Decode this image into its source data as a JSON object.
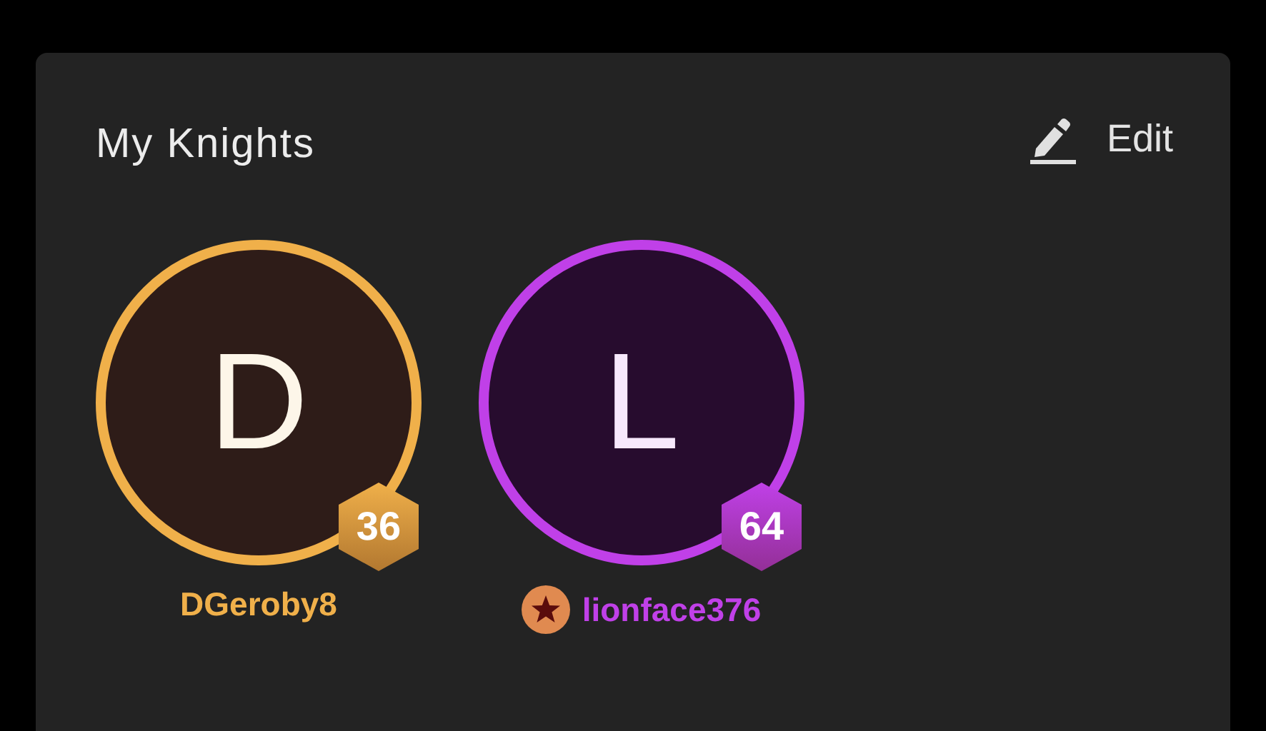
{
  "card": {
    "title": "My Knights",
    "edit_label": "Edit"
  },
  "knights": [
    {
      "initial": "D",
      "level": "36",
      "name": "DGeroby8",
      "color": "#f0b04a",
      "star_badge": false
    },
    {
      "initial": "L",
      "level": "64",
      "name": "lionface376",
      "color": "#c040e8",
      "star_badge": true
    }
  ]
}
